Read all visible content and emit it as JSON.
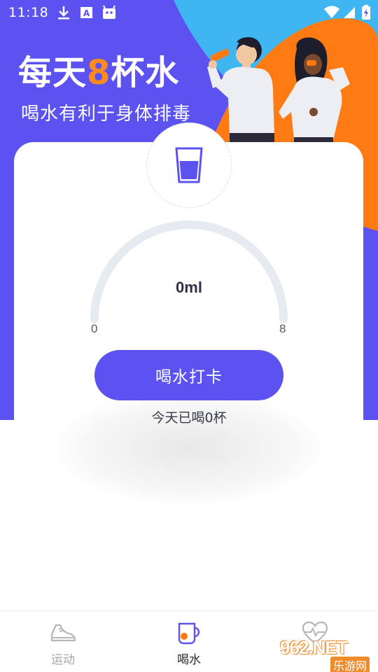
{
  "status_bar": {
    "time": "11:18",
    "icons": [
      "download-icon",
      "app-a-icon",
      "android-icon",
      "wifi-icon",
      "signal-icon",
      "battery-icon"
    ]
  },
  "hero": {
    "headline_prefix": "每天",
    "headline_number": "8",
    "headline_suffix": "杯水",
    "subline": "喝水有利于身体排毒"
  },
  "card": {
    "icon": "water-cup-icon",
    "gauge": {
      "value_text": "0ml",
      "min_label": "0",
      "max_label": "8",
      "current_cups": 0,
      "max_cups": 8
    },
    "checkin_button": "喝水打卡",
    "today_text": "今天已喝0杯"
  },
  "bottom_nav": {
    "items": [
      {
        "label": "运动",
        "icon": "sneaker-icon",
        "active": false
      },
      {
        "label": "喝水",
        "icon": "mug-icon",
        "active": true
      },
      {
        "label": "",
        "icon": "heart-pulse-icon",
        "active": false
      }
    ]
  },
  "watermark": {
    "main": "962.NET",
    "sub": "乐游网"
  },
  "colors": {
    "primary": "#5b52f0",
    "accent_orange": "#ff8a1f",
    "accent_cyan": "#33b5f0",
    "gauge_track": "#e6ebf1"
  }
}
